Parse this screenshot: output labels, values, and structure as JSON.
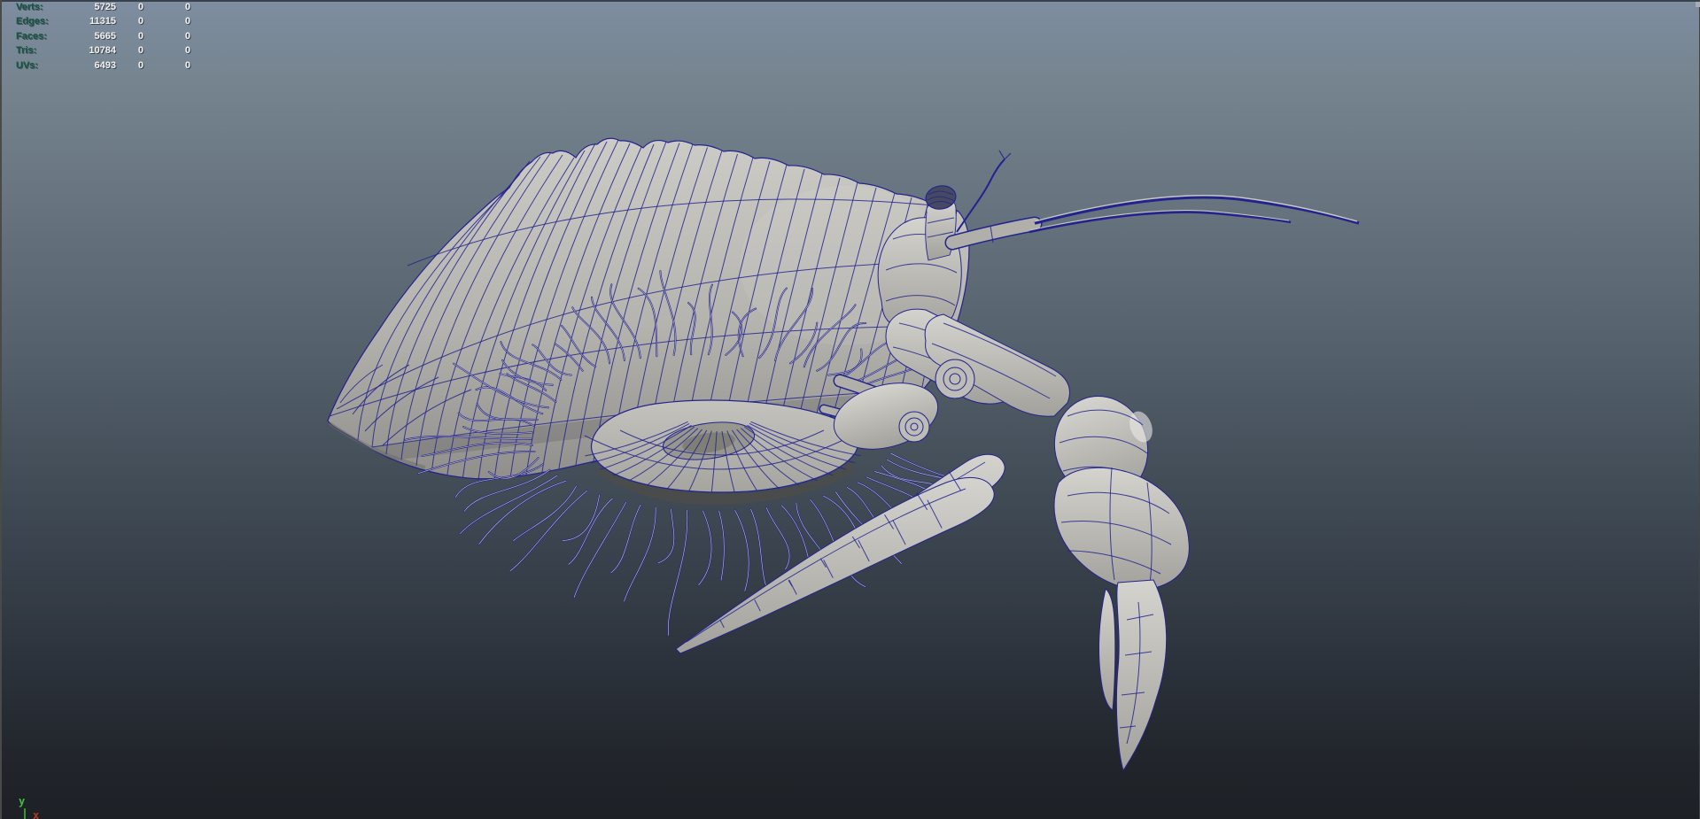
{
  "viewport": {
    "type": "3d-perspective-viewport",
    "model_description": "Hermit crab in conch shell, wireframe-on-shaded gray model",
    "wireframe_color": "#23238e",
    "hair_core_color": "#c9c8c2",
    "surface_color": "#b5b4b0",
    "bg_top_color": "#7e8da0",
    "bg_bottom_color": "#1d2126"
  },
  "hud": {
    "label_color": "#175444",
    "value_color": "#f2f2f2",
    "rows": [
      {
        "label": "Verts:",
        "col1": "5725",
        "col2": "0",
        "col3": "0"
      },
      {
        "label": "Edges:",
        "col1": "11315",
        "col2": "0",
        "col3": "0"
      },
      {
        "label": "Faces:",
        "col1": "5665",
        "col2": "0",
        "col3": "0"
      },
      {
        "label": "Tris:",
        "col1": "10784",
        "col2": "0",
        "col3": "0"
      },
      {
        "label": "UVs:",
        "col1": "6493",
        "col2": "0",
        "col3": "0"
      }
    ]
  },
  "axis_gizmo": {
    "y_label": "y",
    "x_label": "x",
    "y_color": "#3fbf3f",
    "x_color": "#b03a2a"
  }
}
